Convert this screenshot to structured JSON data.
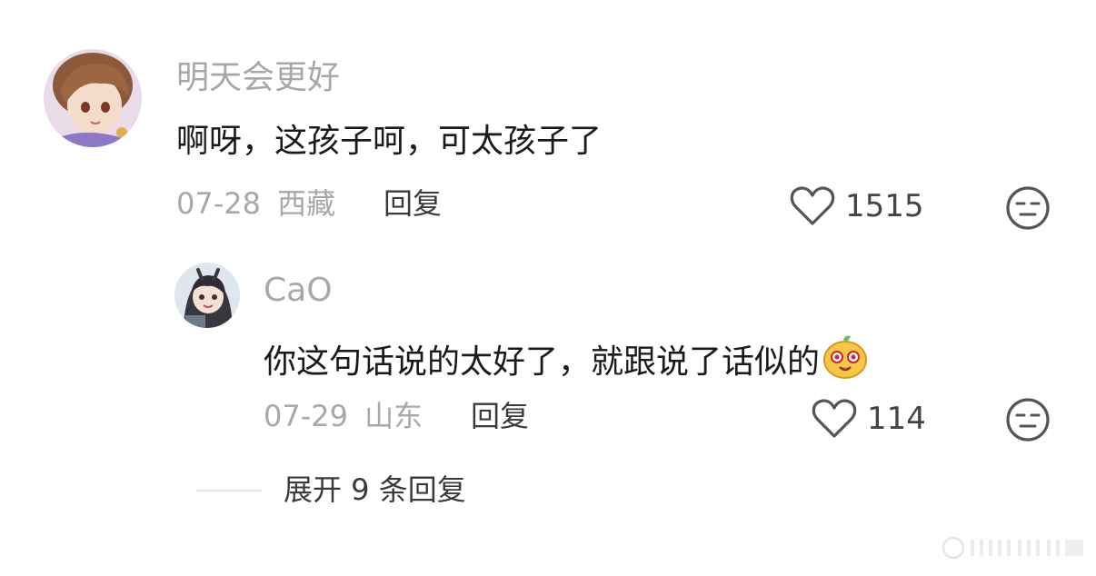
{
  "comment": {
    "username": "明天会更好",
    "text": "啊呀，这孩子呵，可太孩子了",
    "date": "07-28",
    "location": "西藏",
    "reply_label": "回复",
    "likes": "1515"
  },
  "reply": {
    "username": "CaO",
    "text": "你这句话说的太好了，就跟说了话似的",
    "emoji": "smiling-bean-emoji",
    "date": "07-29",
    "location": "山东",
    "reply_label": "回复",
    "likes": "114"
  },
  "expand": {
    "label": "展开 9 条回复"
  },
  "colors": {
    "secondary_text": "#a8a8a8",
    "primary_text": "#1a1a1a",
    "icon": "#555555",
    "emoji_yellow": "#f6c744"
  }
}
